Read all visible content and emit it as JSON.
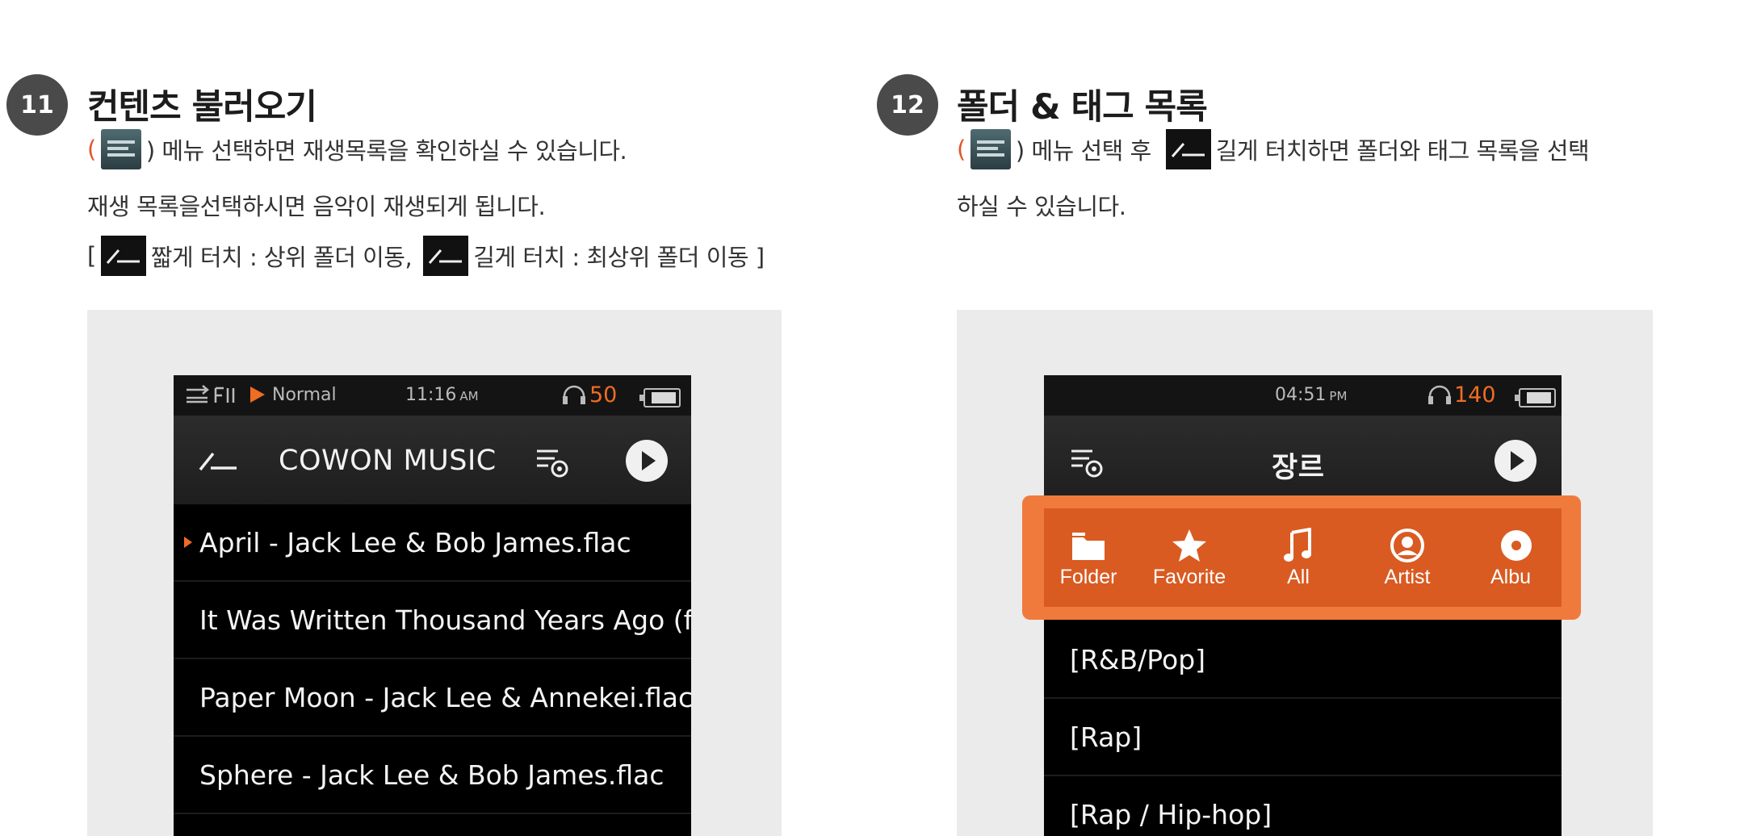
{
  "left": {
    "badge": "11",
    "title": "컨텐츠 불러오기",
    "line1_open": "(",
    "line1_text": ") 메뉴 선택하면 재생목록을 확인하실 수 있습니다.",
    "line2": "재생 목록을선택하시면 음악이 재생되게 됩니다.",
    "line3_open": "[",
    "line3_short": "짧게 터치 : 상위 폴더 이동,",
    "line3_long": "길게 터치 : 최상위 폴더 이동 ]",
    "screen": {
      "status_mode": "Normal",
      "status_time": "11:16",
      "status_ampm": "AM",
      "status_volume": "50",
      "title": "COWON MUSIC",
      "rows": [
        "April - Jack Lee & Bob James.flac",
        "It Was Written Thousand Years Ago (fe",
        "Paper Moon - Jack Lee & Annekei.flac",
        "Sphere - Jack Lee & Bob James.flac"
      ]
    }
  },
  "right": {
    "badge": "12",
    "title": "폴더 & 태그 목록",
    "line1_open": "(",
    "line1_mid": ") 메뉴 선택 후",
    "line1_end": "길게 터치하면 폴더와 태그 목록을 선택",
    "line2": "하실 수 있습니다.",
    "screen": {
      "status_time": "04:51",
      "status_ampm": "PM",
      "status_volume": "140",
      "title": "장르",
      "tags": [
        "Folder",
        "Favorite",
        "All",
        "Artist",
        "Albu"
      ],
      "rows": [
        "[R&B/Pop]",
        "[Rap]",
        "[Rap / Hip-hop]"
      ]
    }
  },
  "colors": {
    "accent": "#ef6c23",
    "highlight": "#f07a3c",
    "badge": "#4a4a4a"
  }
}
